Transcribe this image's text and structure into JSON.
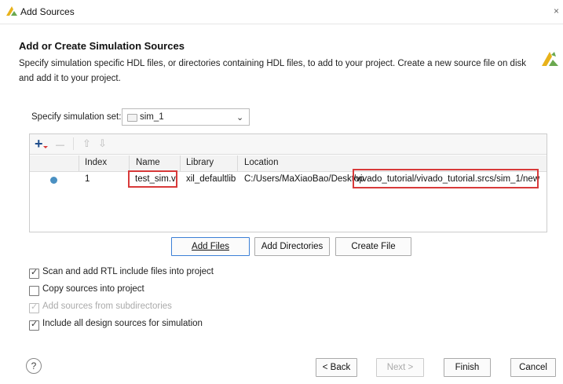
{
  "window": {
    "title": "Add Sources",
    "close_glyph": "×"
  },
  "header": {
    "heading": "Add or Create Simulation Sources",
    "description": "Specify simulation specific HDL files, or directories containing HDL files, to add to your project. Create a new source file on disk and add it to your project."
  },
  "simset": {
    "label": "Specify simulation set:",
    "value": "sim_1"
  },
  "toolbar": {
    "add_glyph": "+",
    "remove_glyph": "—",
    "up_glyph": "⇧",
    "down_glyph": "⇩"
  },
  "table": {
    "columns": [
      "Index",
      "Name",
      "Library",
      "Location"
    ],
    "rows": [
      {
        "index": "1",
        "name": "test_sim.v",
        "library": "xil_defaultlib",
        "location_prefix": "C:/Users/MaXiaoBao/Desktop",
        "location_suffix": "/vivado_tutorial/vivado_tutorial.srcs/sim_1/new"
      }
    ]
  },
  "actions": {
    "add_files": "Add Files",
    "add_directories": "Add Directories",
    "create_file": "Create File"
  },
  "options": [
    {
      "label": "Scan and add RTL include files into project",
      "checked": true,
      "disabled": false
    },
    {
      "label": "Copy sources into project",
      "checked": false,
      "disabled": false
    },
    {
      "label": "Add sources from subdirectories",
      "checked": true,
      "disabled": true
    },
    {
      "label": "Include all design sources for simulation",
      "checked": true,
      "disabled": false
    }
  ],
  "footer": {
    "help_glyph": "?",
    "back": "< Back",
    "next": "Next >",
    "finish": "Finish",
    "cancel": "Cancel"
  },
  "colors": {
    "accent": "#3c7fd6",
    "highlight_box": "#d83a3a",
    "logo_yellow": "#e8b21a",
    "logo_green": "#6aa84f"
  }
}
